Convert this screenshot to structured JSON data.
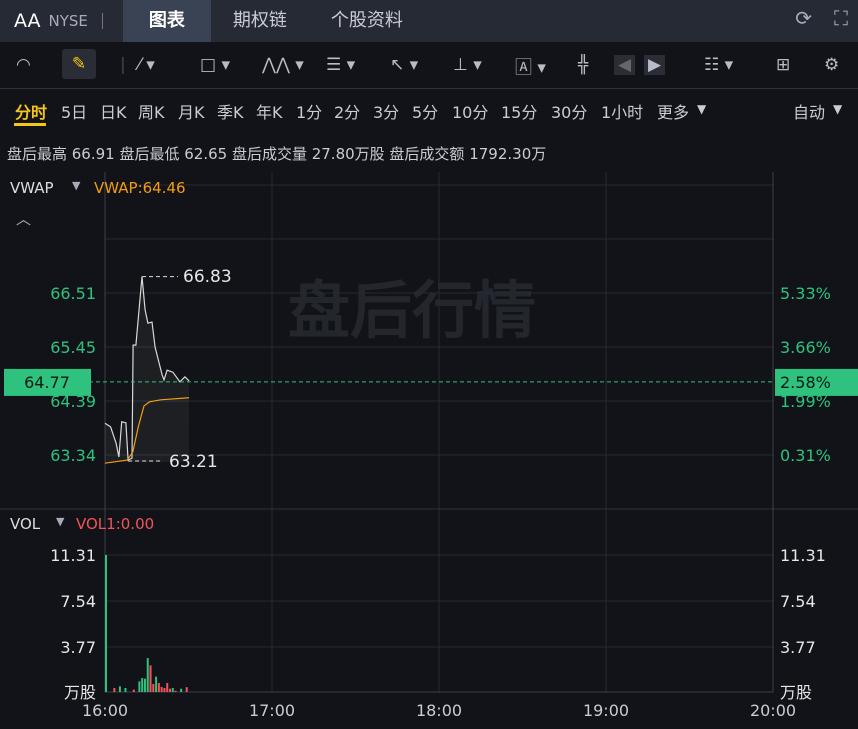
{
  "header": {
    "symbol": "AA",
    "exchange": "NYSE",
    "tabs": [
      "图表",
      "期权链",
      "个股资料"
    ],
    "active_tab": "图表"
  },
  "toolbar": {
    "icons": [
      "gauge-icon",
      "pencil-icon",
      "line-tool-icon",
      "rectangle-tool-icon",
      "pattern-tool-icon",
      "fib-tool-icon",
      "arrow-tool-icon",
      "measure-tool-icon",
      "text-tool-icon",
      "candle-icon",
      "prev-icon",
      "next-icon",
      "layout-list-icon",
      "grid-icon",
      "settings-icon"
    ]
  },
  "periods": {
    "items": [
      "分时",
      "5日",
      "日K",
      "周K",
      "月K",
      "季K",
      "年K",
      "1分",
      "2分",
      "3分",
      "5分",
      "10分",
      "15分",
      "30分",
      "1小时",
      "更多"
    ],
    "active": "分时",
    "auto": "自动"
  },
  "stats": "盘后最高 66.91 盘后最低 62.65 盘后成交量 27.80万股 盘后成交额 1792.30万",
  "price_panel": {
    "indicator": "VWAP",
    "vwap_label": "VWAP:64.46",
    "watermark": "盘后行情",
    "current_price": "64.77",
    "current_pct": "2.58%",
    "high_label": "66.83",
    "low_label": "63.21",
    "left_ticks": [
      "66.51",
      "65.45",
      "64.39",
      "63.34"
    ],
    "right_ticks": [
      "5.33%",
      "3.66%",
      "1.99%",
      "0.31%"
    ]
  },
  "vol_panel": {
    "indicator": "VOL",
    "vol_label": "VOL1:0.00",
    "ticks": [
      "11.31",
      "7.54",
      "3.77"
    ],
    "unit": "万股"
  },
  "x_ticks": [
    "16:00",
    "17:00",
    "18:00",
    "19:00",
    "20:00"
  ],
  "colors": {
    "up": "#2ec27e",
    "down": "#f0555a",
    "vwap": "#f39c12",
    "accent": "#f5c518"
  },
  "chart_data": {
    "type": "line",
    "x_unit": "minutes after 16:00",
    "ylim": [
      62.6,
      67.5
    ],
    "price": [
      [
        0,
        63.96
      ],
      [
        2,
        63.89
      ],
      [
        4,
        63.57
      ],
      [
        5,
        63.3
      ],
      [
        6,
        63.99
      ],
      [
        7.5,
        63.97
      ],
      [
        8.3,
        63.24
      ],
      [
        9.7,
        63.28
      ],
      [
        10.1,
        65.49
      ],
      [
        11.1,
        65.49
      ],
      [
        13.3,
        66.83
      ],
      [
        14.4,
        66.18
      ],
      [
        15.4,
        65.92
      ],
      [
        16.9,
        65.94
      ],
      [
        18,
        65.45
      ],
      [
        20.5,
        64.91
      ],
      [
        21.2,
        64.81
      ],
      [
        22.3,
        65.0
      ],
      [
        24.4,
        64.96
      ],
      [
        26.9,
        64.77
      ],
      [
        28.7,
        64.87
      ],
      [
        30.2,
        64.79
      ]
    ],
    "vwap": [
      [
        0,
        63.18
      ],
      [
        8,
        63.24
      ],
      [
        10,
        63.4
      ],
      [
        12,
        63.9
      ],
      [
        14,
        64.3
      ],
      [
        16,
        64.38
      ],
      [
        20,
        64.42
      ],
      [
        30.2,
        64.46
      ]
    ],
    "volume": [
      [
        0,
        11.31,
        "up"
      ],
      [
        3,
        0.33,
        "down"
      ],
      [
        5,
        0.47,
        "up"
      ],
      [
        7,
        0.33,
        "up"
      ],
      [
        10,
        0.2,
        "down"
      ],
      [
        12,
        0.88,
        "up"
      ],
      [
        13,
        1.15,
        "up"
      ],
      [
        14,
        1.1,
        "up"
      ],
      [
        15,
        2.8,
        "up"
      ],
      [
        16,
        2.2,
        "down"
      ],
      [
        17,
        0.66,
        "down"
      ],
      [
        18,
        1.27,
        "up"
      ],
      [
        19,
        0.74,
        "down"
      ],
      [
        20,
        0.41,
        "down"
      ],
      [
        21,
        0.33,
        "down"
      ],
      [
        22,
        0.74,
        "down"
      ],
      [
        23,
        0.27,
        "down"
      ],
      [
        24,
        0.33,
        "up"
      ],
      [
        25,
        0.1,
        "down"
      ],
      [
        27,
        0.27,
        "up"
      ],
      [
        29,
        0.4,
        "down"
      ]
    ]
  }
}
